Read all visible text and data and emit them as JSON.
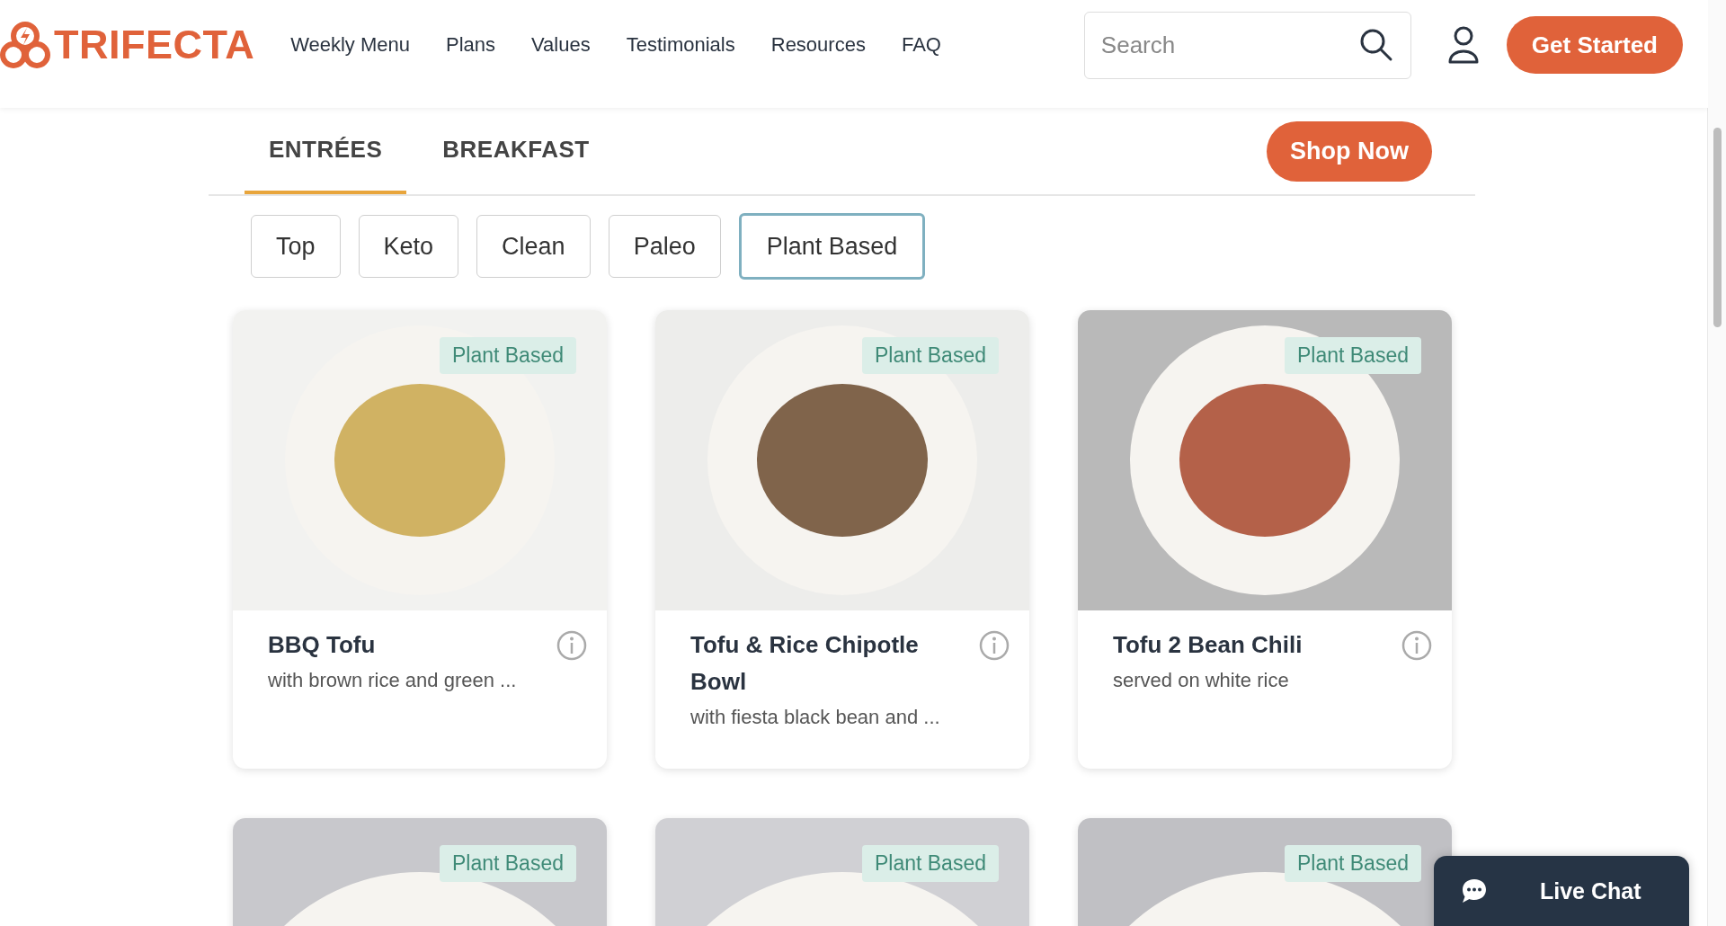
{
  "header": {
    "logo": "TRIFECTA",
    "nav": [
      {
        "label": "Weekly Menu"
      },
      {
        "label": "Plans"
      },
      {
        "label": "Values"
      },
      {
        "label": "Testimonials"
      },
      {
        "label": "Resources"
      },
      {
        "label": "FAQ"
      }
    ],
    "search": {
      "placeholder": "Search"
    },
    "cta": "Get Started"
  },
  "tabs": [
    {
      "label": "ENTRÉES",
      "selected": true
    },
    {
      "label": "BREAKFAST",
      "selected": false
    }
  ],
  "shop_button": "Shop Now",
  "filters": [
    {
      "label": "Top",
      "selected": false
    },
    {
      "label": "Keto",
      "selected": false
    },
    {
      "label": "Clean",
      "selected": false
    },
    {
      "label": "Paleo",
      "selected": false
    },
    {
      "label": "Plant Based",
      "selected": true
    }
  ],
  "meals": [
    {
      "badge": "Plant Based",
      "name": "BBQ Tofu",
      "description": "with brown rice and green ..."
    },
    {
      "badge": "Plant Based",
      "name": "Tofu & Rice Chipotle Bowl",
      "description": "with fiesta black bean and ..."
    },
    {
      "badge": "Plant Based",
      "name": "Tofu 2 Bean Chili",
      "description": "served on white rice"
    },
    {
      "badge": "Plant Based"
    },
    {
      "badge": "Plant Based"
    },
    {
      "badge": "Plant Based"
    }
  ],
  "live_chat": "Live Chat"
}
